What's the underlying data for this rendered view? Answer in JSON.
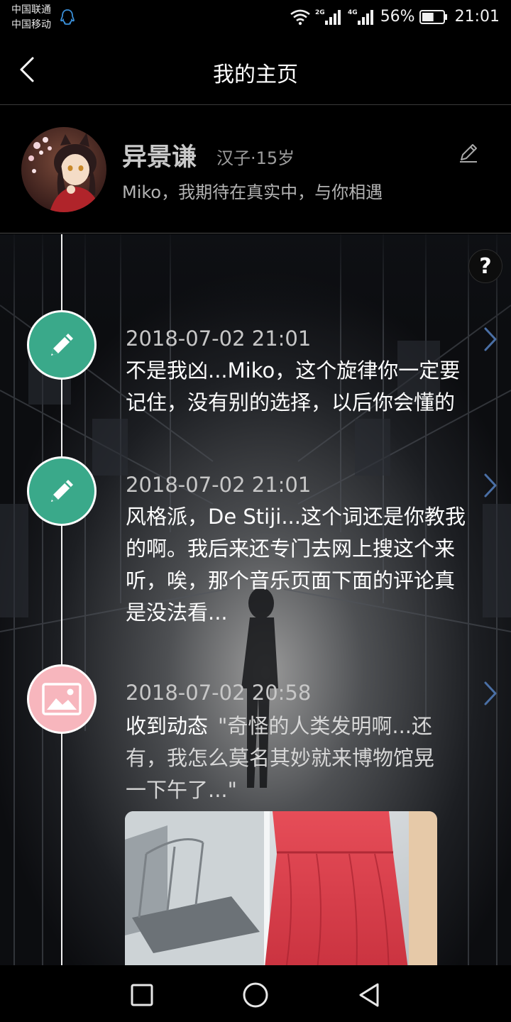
{
  "status_bar": {
    "carrier_1": "中国联通",
    "carrier_2": "中国移动",
    "net_1": "2G",
    "net_2": "4G",
    "battery": "56%",
    "battery_level": 0.56,
    "time": "21:01"
  },
  "nav": {
    "title": "我的主页"
  },
  "profile": {
    "name": "异景谦",
    "meta": "汉子·15岁",
    "bio": "Miko，我期待在真实中，与你相遇"
  },
  "help": {
    "label": "?"
  },
  "timeline": {
    "entries": [
      {
        "type": "note",
        "icon": "pencil-icon",
        "time": "2018-07-02 21:01",
        "lines": [
          "不是我凶...Miko，这个旋律你一定要",
          "记住，没有别的选择，以后你会懂的"
        ]
      },
      {
        "type": "note",
        "icon": "pencil-icon",
        "time": "2018-07-02 21:01",
        "lines": [
          "风格派，De Stiji...这个词还是你教我",
          "的啊。我后来还专门去网上搜这个来",
          "听，唉，那个音乐页面下面的评论真",
          "是没法看..."
        ]
      },
      {
        "type": "moment",
        "icon": "image-icon",
        "time": "2018-07-02 20:58",
        "label": "收到动态",
        "lines": [
          "\"奇怪的人类发明啊...还",
          "有，我怎么莫名其妙就来博物馆晃",
          "一下午了...\""
        ]
      }
    ]
  },
  "colors": {
    "note_icon_bg": "#3aa98a",
    "moment_icon_bg": "#f7b6bd",
    "accent_blue": "#4a6fa5"
  }
}
